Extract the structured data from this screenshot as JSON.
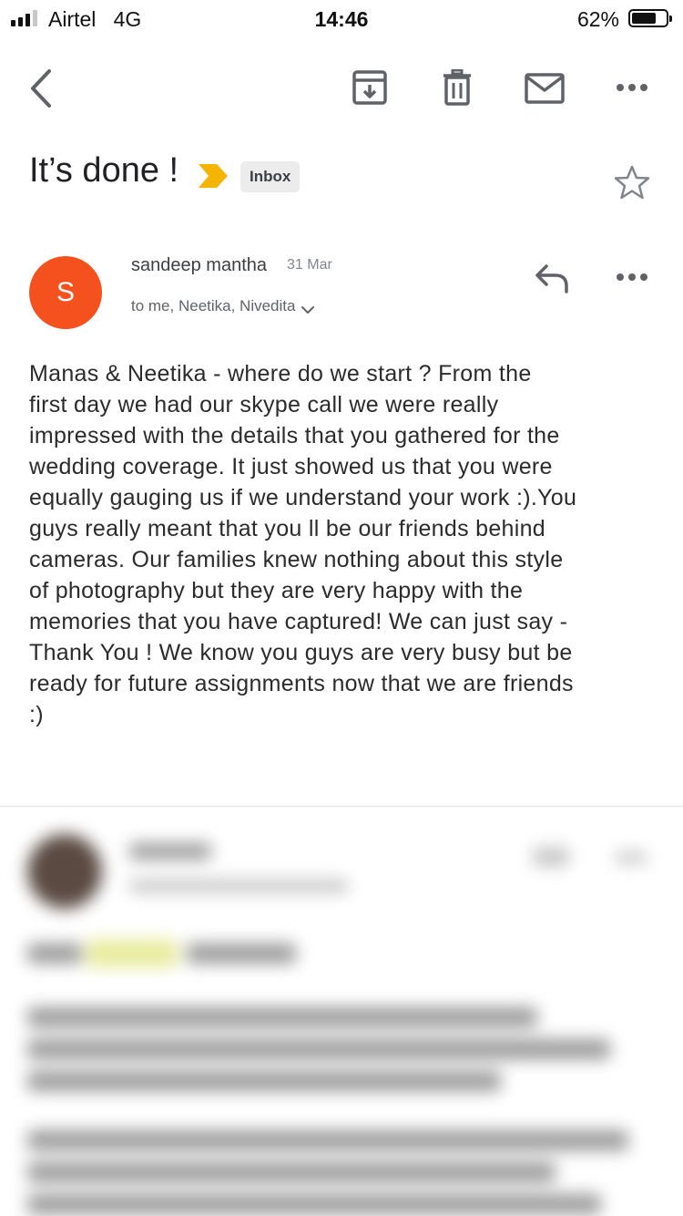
{
  "status_bar": {
    "carrier": "Airtel",
    "network": "4G",
    "time": "14:46",
    "battery_percent": "62%",
    "battery_level": 0.62
  },
  "toolbar": {
    "back_icon": "chevron-left-icon",
    "archive_icon": "archive-icon",
    "delete_icon": "trash-icon",
    "mark_unread_icon": "mail-icon",
    "more_icon": "more-horizontal-icon"
  },
  "email": {
    "subject": "It’s done !",
    "label": "Inbox",
    "importance_color": "#f4b400",
    "sender": {
      "initial": "S",
      "name": "sandeep mantha",
      "date": "31 Mar",
      "recipients": "to me, Neetika, Nivedita",
      "avatar_color": "#f4511e"
    },
    "body": "Manas & Neetika - where do we start ? From the\nfirst day we had our skype call we were really\nimpressed with the details that you gathered for the\nwedding coverage. It just showed us that you were\nequally gauging us if we understand your work :).You\nguys really meant that you ll be our friends behind\ncameras. Our families knew nothing about this style\nof photography but they are very happy with the\nmemories that you have captured! We can just say -\nThank You ! We know you guys are very busy but be\nready for future assignments now that we are friends\n:)"
  }
}
